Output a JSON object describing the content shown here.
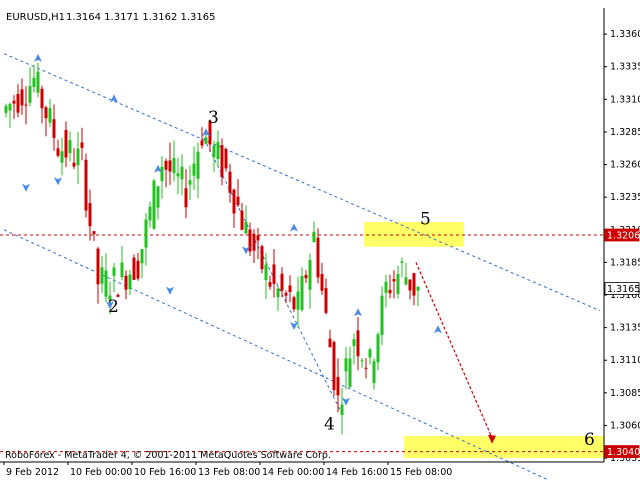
{
  "header": {
    "symbol": "EURUSD,H1",
    "ohlc": "1.3164 1.3171 1.3162 1.3165"
  },
  "footer": {
    "copyright": "RoboForex - MetaTrader 4, © 2001-2011 MetaQuotes Software Corp."
  },
  "colors": {
    "bull": "#22c022",
    "bear": "#cc0000",
    "channel": "#2f6fd0",
    "resistance": "#d00000",
    "target_zone": "#ffff66",
    "price_label_bg": "#cc0000",
    "current_label_bg": "#ffffff",
    "arrow": "#4a8ae8"
  },
  "icons": {
    "fractal": "fractal-arrow-icon"
  },
  "chart_data": {
    "type": "candlestick",
    "symbol": "EURUSD",
    "timeframe": "H1",
    "ylim": [
      1.3032,
      1.338
    ],
    "y_ticks": [
      1.336,
      1.3335,
      1.331,
      1.3285,
      1.326,
      1.3235,
      1.321,
      1.3185,
      1.316,
      1.3135,
      1.311,
      1.3085,
      1.306,
      1.3035
    ],
    "x_ticks": [
      "9 Feb 2012",
      "10 Feb 00:00",
      "10 Feb 16:00",
      "13 Feb 08:00",
      "14 Feb 00:00",
      "14 Feb 16:00",
      "15 Feb 08:00"
    ],
    "x_tick_bars": [
      0,
      16,
      32,
      48,
      64,
      80,
      96
    ],
    "bars_total": 150,
    "current_price": "1.3165",
    "resistance_level": {
      "value": "1.3206"
    },
    "target_level": {
      "value": "1.3040"
    },
    "wave_labels": [
      {
        "label": "2",
        "bar": 26,
        "price": 1.3147
      },
      {
        "label": "3",
        "bar": 51,
        "price": 1.3292
      },
      {
        "label": "4",
        "bar": 80,
        "price": 1.3057
      },
      {
        "label": "5",
        "bar": 104,
        "price": 1.3214
      },
      {
        "label": "6",
        "bar": 145,
        "price": 1.3045
      }
    ],
    "channel_lines": [
      {
        "from": [
          0,
          1.3345
        ],
        "to": [
          149,
          1.3148
        ]
      },
      {
        "from": [
          0,
          1.321
        ],
        "to": [
          149,
          1.3
        ]
      }
    ],
    "wave_lines": [
      {
        "from": [
          50,
          1.328
        ],
        "to": [
          84,
          1.3072
        ]
      }
    ],
    "zones": [
      {
        "bars": [
          90,
          115
        ],
        "range": [
          1.3197,
          1.3216
        ]
      },
      {
        "bars": [
          100,
          150
        ],
        "range": [
          1.3035,
          1.3052
        ]
      }
    ],
    "forecast_arrow": {
      "from": [
        103,
        1.3185
      ],
      "to": [
        122,
        1.3046
      ]
    },
    "fractals_up": [
      [
        8,
        1.3341
      ],
      [
        27,
        1.331
      ],
      [
        50,
        1.3284
      ],
      [
        38,
        1.3256
      ],
      [
        72,
        1.3211
      ],
      [
        88,
        1.3146
      ],
      [
        108,
        1.3133
      ]
    ],
    "fractals_down": [
      [
        5,
        1.3243
      ],
      [
        13,
        1.3248
      ],
      [
        26,
        1.3153
      ],
      [
        41,
        1.3164
      ],
      [
        60,
        1.3195
      ],
      [
        72,
        1.3137
      ],
      [
        85,
        1.3079
      ]
    ]
  }
}
